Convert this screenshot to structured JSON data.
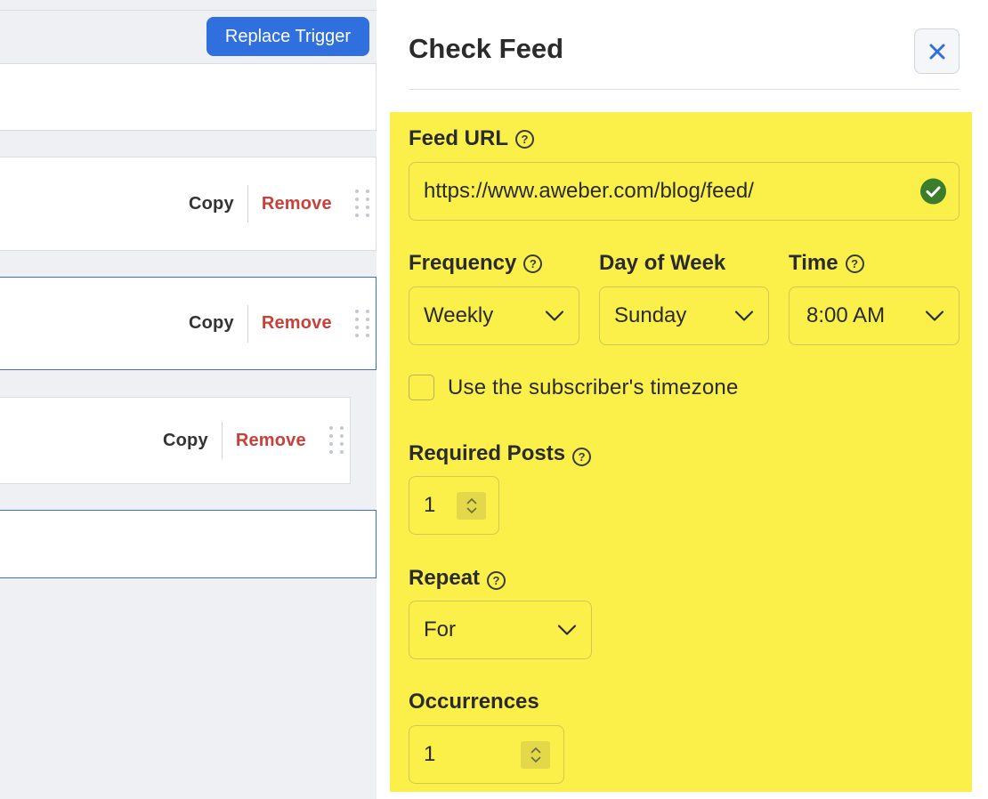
{
  "canvas": {
    "replace_trigger_label": "Replace Trigger",
    "steps": [
      {
        "copy_label": "Copy",
        "remove_label": "Remove"
      },
      {
        "copy_label": "Copy",
        "remove_label": "Remove"
      },
      {
        "copy_label": "Copy",
        "remove_label": "Remove"
      }
    ]
  },
  "panel": {
    "title": "Check Feed",
    "close_icon": "close-icon",
    "feed_url": {
      "label": "Feed URL",
      "value": "https://www.aweber.com/blog/feed/",
      "status_icon": "check-circle-icon"
    },
    "frequency": {
      "label": "Frequency",
      "value": "Weekly"
    },
    "day_of_week": {
      "label": "Day of Week",
      "value": "Sunday"
    },
    "time": {
      "label": "Time",
      "value": "8:00 AM"
    },
    "subscriber_timezone": {
      "label": "Use the subscriber's timezone",
      "checked": false
    },
    "required_posts": {
      "label": "Required Posts",
      "value": "1"
    },
    "repeat": {
      "label": "Repeat",
      "value": "For"
    },
    "occurrences": {
      "label": "Occurrences",
      "value": "1"
    }
  },
  "colors": {
    "primary_button": "#2f6fde",
    "remove": "#c9403b",
    "highlight": "#fbef4a",
    "valid": "#3b7d2a"
  }
}
